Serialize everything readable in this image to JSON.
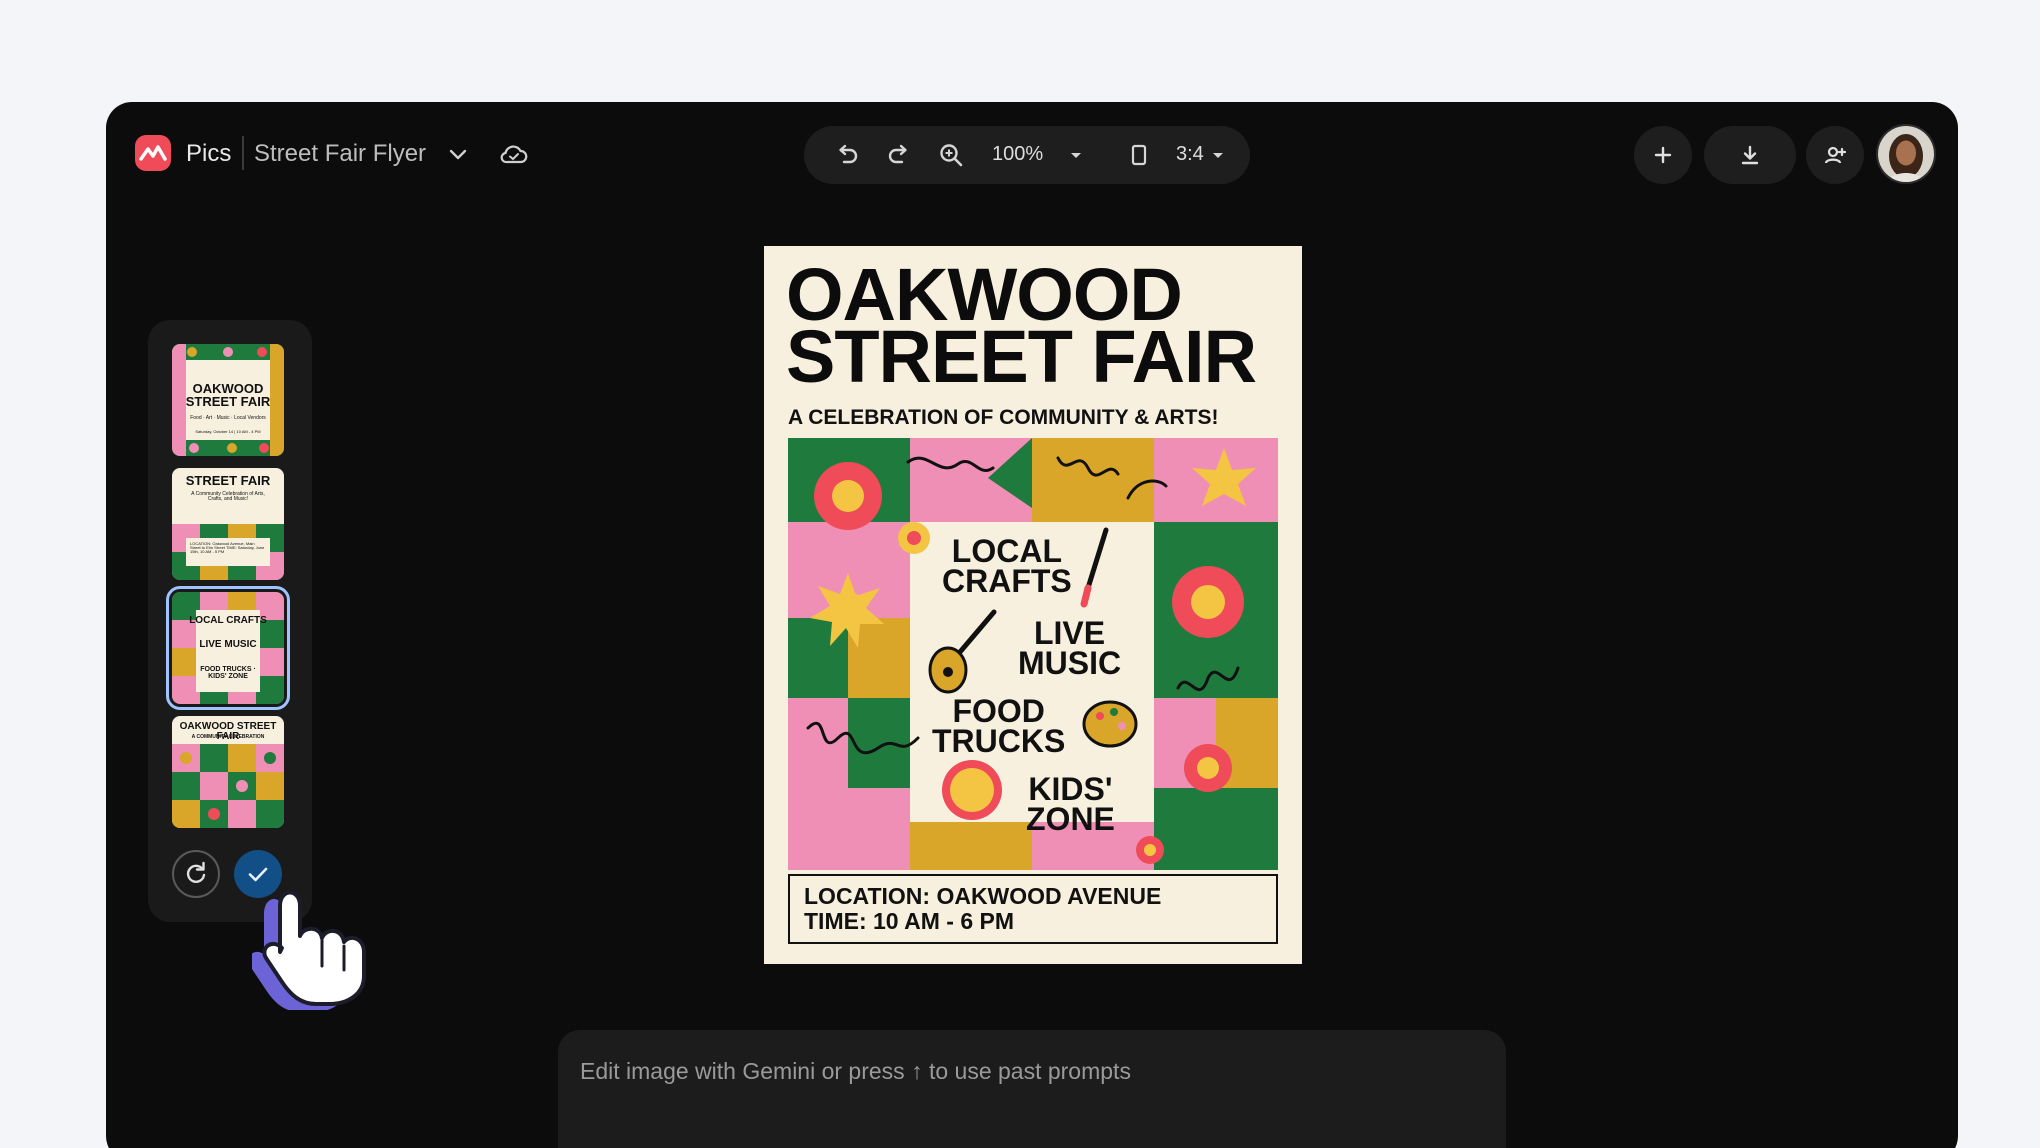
{
  "app": {
    "name": "Pics",
    "document_title": "Street Fair Flyer",
    "logo_icon": "pics-logo-icon",
    "accent_color": "#ef4b59"
  },
  "toolbar": {
    "undo_icon": "undo-icon",
    "redo_icon": "redo-icon",
    "zoom_icon": "zoom-in-icon",
    "zoom_value": "100%",
    "aspect_icon": "portrait-frame-icon",
    "aspect_ratio": "3:4"
  },
  "actions": {
    "add_icon": "plus-icon",
    "download_icon": "download-icon",
    "share_icon": "add-person-icon"
  },
  "variants": [
    {
      "title": "OAKWOOD STREET FAIR",
      "line": "Food · Art · Music · Local Vendors",
      "footer": "Saturday, October 14 | 10 AM - 4 PM"
    },
    {
      "title": "STREET FAIR",
      "line": "A Community Celebration of Arts, Crafts, and Music!",
      "footer": "LOCATION: Oakwood Avenue, Main Street to Elm Street TIME: Saturday, June 15th, 10 AM - 5 PM"
    },
    {
      "title": "LOCAL CRAFTS",
      "line": "LIVE MUSIC",
      "footer": "FOOD TRUCKS · KIDS' ZONE",
      "selected": true
    },
    {
      "title": "OAKWOOD STREET FAIR",
      "line": "A COMMUNITY CELEBRATION",
      "footer": ""
    }
  ],
  "poster": {
    "title_line1": "OAKWOOD",
    "title_line2": "STREET FAIR",
    "subtitle": "A CELEBRATION OF COMMUNITY & ARTS!",
    "items": [
      "LOCAL CRAFTS",
      "LIVE MUSIC",
      "FOOD TRUCKS",
      "KIDS' ZONE"
    ],
    "item_lines": {
      "crafts1": "LOCAL",
      "crafts2": "CRAFTS",
      "music1": "LIVE",
      "music2": "MUSIC",
      "food1": "FOOD",
      "food2": "TRUCKS",
      "kids1": "KIDS'",
      "kids2": "ZONE"
    },
    "location": "LOCATION: OAKWOOD AVENUE",
    "time": "TIME: 10 AM - 6 PM",
    "colors": {
      "green": "#1f7a3e",
      "pink": "#ef8fb5",
      "mustard": "#d9a62a",
      "cream": "#f7f0de"
    }
  },
  "prompt": {
    "placeholder": "Edit image with Gemini or press ↑ to use past prompts"
  },
  "rail_actions": {
    "regenerate_icon": "refresh-icon",
    "confirm_icon": "checkmark-icon"
  }
}
